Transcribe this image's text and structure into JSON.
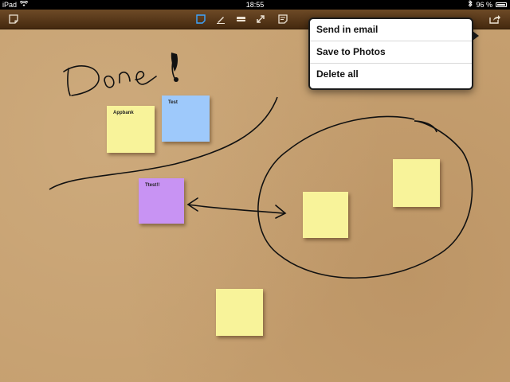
{
  "status": {
    "device": "iPad",
    "time": "18:55",
    "battery": "96 %"
  },
  "toolbar": {
    "new_note_icon": "sticky-note-icon",
    "tools": [
      "note-tool-icon",
      "pen-icon",
      "eraser-icon",
      "resize-icon",
      "note-list-icon"
    ],
    "share_icon": "share-icon"
  },
  "board": {
    "handwriting": "Done!",
    "notes": [
      {
        "id": "n1",
        "text": "Appbank",
        "color": "yellow"
      },
      {
        "id": "n2",
        "text": "Test",
        "color": "blue"
      },
      {
        "id": "n3",
        "text": "Ttest!!",
        "color": "purple"
      },
      {
        "id": "n4",
        "text": "",
        "color": "yellow"
      },
      {
        "id": "n5",
        "text": "",
        "color": "yellow"
      },
      {
        "id": "n6",
        "text": "",
        "color": "yellow"
      }
    ]
  },
  "menu": {
    "items": [
      "Send in email",
      "Save to Photos",
      "Delete all"
    ]
  }
}
